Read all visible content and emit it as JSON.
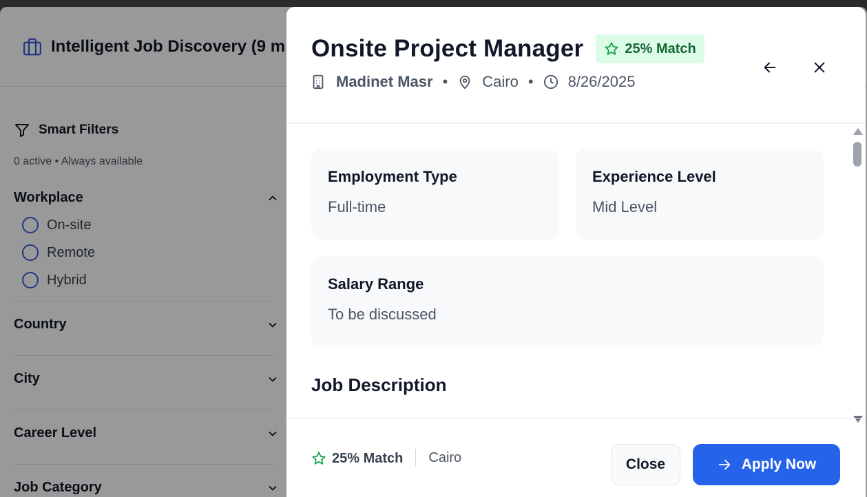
{
  "background": {
    "app_title": "Intelligent Job Discovery (9 m",
    "filters": {
      "title": "Smart Filters",
      "subtitle": "0 active • Always available",
      "sections": {
        "workplace": {
          "label": "Workplace",
          "options": [
            "On-site",
            "Remote",
            "Hybrid"
          ]
        },
        "country": {
          "label": "Country"
        },
        "city": {
          "label": "City"
        },
        "career_level": {
          "label": "Career Level"
        },
        "job_category": {
          "label": "Job Category"
        }
      }
    }
  },
  "job": {
    "title": "Onsite Project Manager",
    "match_badge": "25% Match",
    "company": "Madinet Masr",
    "location": "Cairo",
    "date": "8/26/2025",
    "separator": "•",
    "details": {
      "employment_type": {
        "label": "Employment Type",
        "value": "Full-time"
      },
      "experience_level": {
        "label": "Experience Level",
        "value": "Mid Level"
      },
      "salary_range": {
        "label": "Salary Range",
        "value": "To be discussed"
      }
    },
    "description_title": "Job Description"
  },
  "footer": {
    "match": "25% Match",
    "city": "Cairo",
    "close_label": "Close",
    "apply_label": "Apply Now"
  },
  "colors": {
    "primary": "#2563eb",
    "match_bg": "#dcfce7",
    "match_fg": "#166534",
    "radio_border": "#3b5bdb"
  },
  "icons": {
    "app": "briefcase-icon",
    "filters": "funnel-icon",
    "match": "star-icon",
    "company": "building-icon",
    "location": "map-pin-icon",
    "date": "clock-icon",
    "back": "arrow-left-icon",
    "close": "close-icon",
    "apply": "arrow-right-icon"
  }
}
